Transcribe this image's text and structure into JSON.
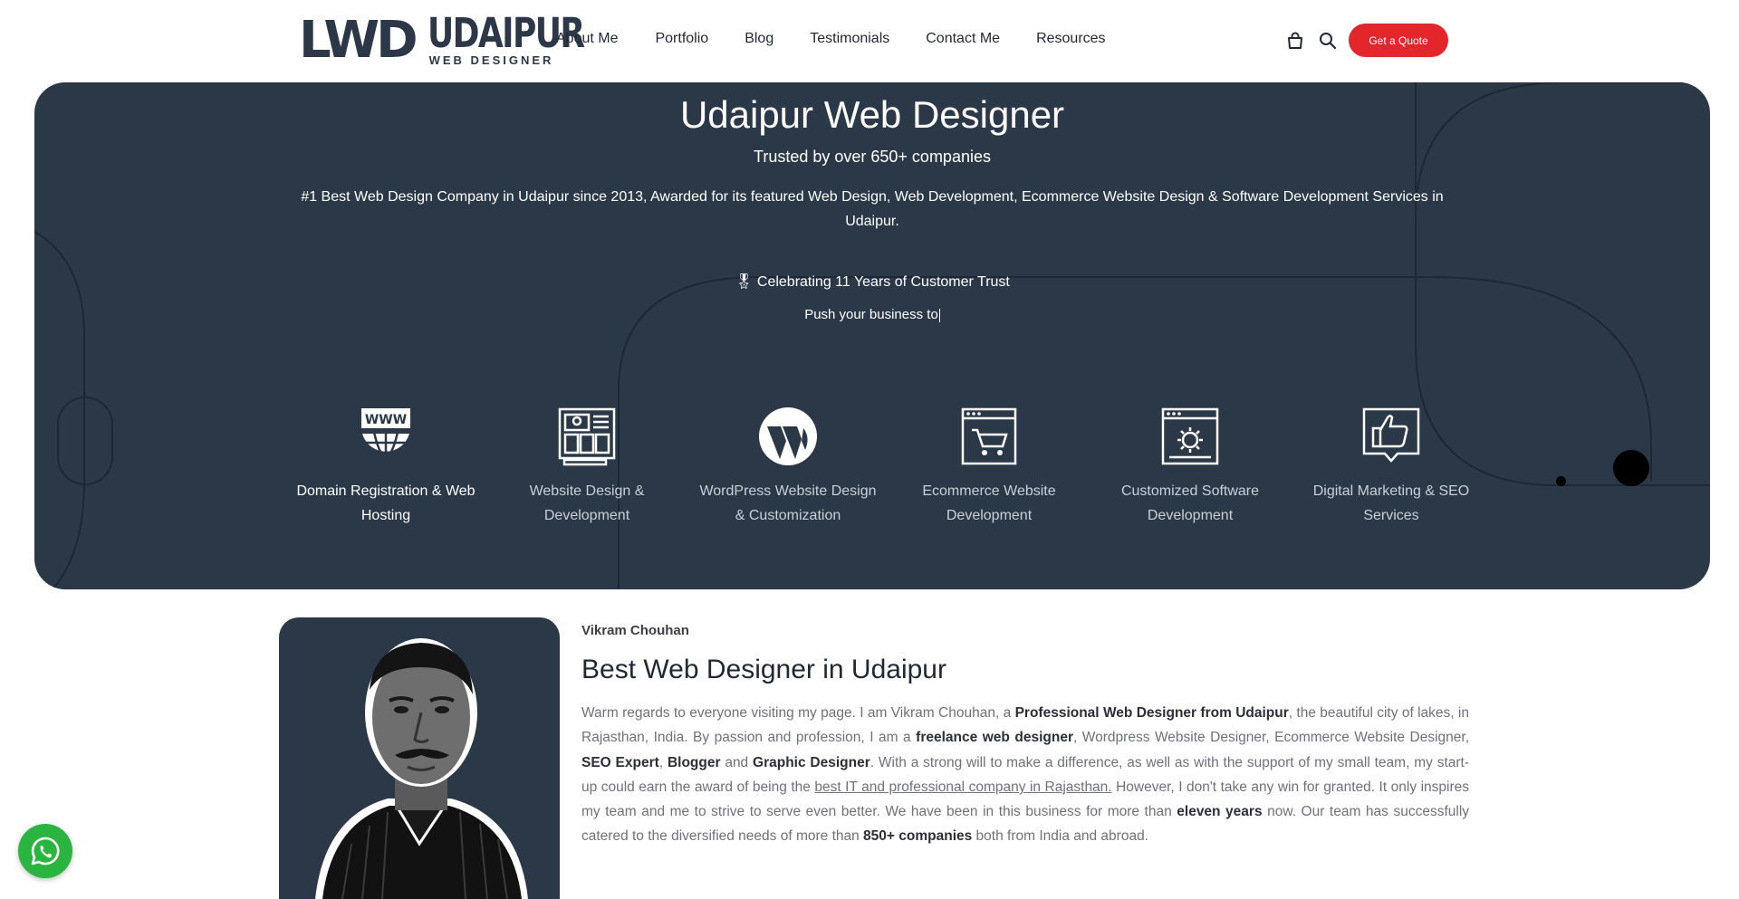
{
  "logo": {
    "mark": "LWD",
    "main": "UDAIPUR",
    "sub": "WEB DESIGNER"
  },
  "nav": {
    "items": [
      "About Me",
      "Portfolio",
      "Blog",
      "Testimonials",
      "Contact Me",
      "Resources"
    ]
  },
  "header": {
    "quote_label": "Get a Quote",
    "cart_icon": "shopping-bag-icon",
    "search_icon": "search-icon"
  },
  "hero": {
    "title": "Udaipur Web Designer",
    "subtitle": "Trusted by over 650+ companies",
    "description": "#1 Best Web Design Company in Udaipur since 2013, Awarded for its featured Web Design, Web Development, Ecommerce Website Design & Software Development Services in Udaipur.",
    "celebrate": "🎖 Celebrating 11 Years of Customer Trust",
    "push": "Push your business to",
    "bg_color": "#2b3848"
  },
  "services": [
    {
      "label": "Domain Registration & Web Hosting",
      "icon": "www-globe-icon"
    },
    {
      "label": "Website Design & Development",
      "icon": "web-layout-icon"
    },
    {
      "label": "WordPress Website Design & Customization",
      "icon": "wordpress-icon"
    },
    {
      "label": "Ecommerce Website Development",
      "icon": "cart-browser-icon"
    },
    {
      "label": "Customized Software Development",
      "icon": "gear-browser-icon"
    },
    {
      "label": "Digital Marketing & SEO Services",
      "icon": "thumbs-up-icon"
    }
  ],
  "about": {
    "name": "Vikram Chouhan",
    "title": "Best Web Designer in Udaipur",
    "body": [
      {
        "t": "Warm regards to everyone visiting my page. I am Vikram Chouhan, a "
      },
      {
        "t": "Professional Web Designer from Udaipur",
        "b": true
      },
      {
        "t": ", the beautiful city of lakes, in Rajasthan, India. By passion and profession, I am a "
      },
      {
        "t": "freelance web designer",
        "b": true
      },
      {
        "t": ", Wordpress Website Designer, Ecommerce Website Designer, "
      },
      {
        "t": "SEO Expert",
        "b": true
      },
      {
        "t": ", "
      },
      {
        "t": "Blogger",
        "b": true
      },
      {
        "t": " and "
      },
      {
        "t": "Graphic Designer",
        "b": true
      },
      {
        "t": ". With a strong will to make a difference, as well as with the support of my small team, my start-up could earn the award of being the "
      },
      {
        "t": "best IT and professional company in Rajasthan.",
        "u": true
      },
      {
        "t": " However, I don't take any win for granted. It only inspires my team and me to strive to serve even better. We have been in this business for more than "
      },
      {
        "t": "eleven years",
        "b": true
      },
      {
        "t": " now. Our team has successfully catered to the diversified needs of more than "
      },
      {
        "t": "850+ companies",
        "b": true
      },
      {
        "t": " both from India and abroad."
      }
    ]
  },
  "colors": {
    "accent": "#e3262c",
    "dark": "#2b3848",
    "whatsapp": "#2ab540"
  },
  "floating": {
    "whatsapp_icon": "whatsapp-icon"
  }
}
